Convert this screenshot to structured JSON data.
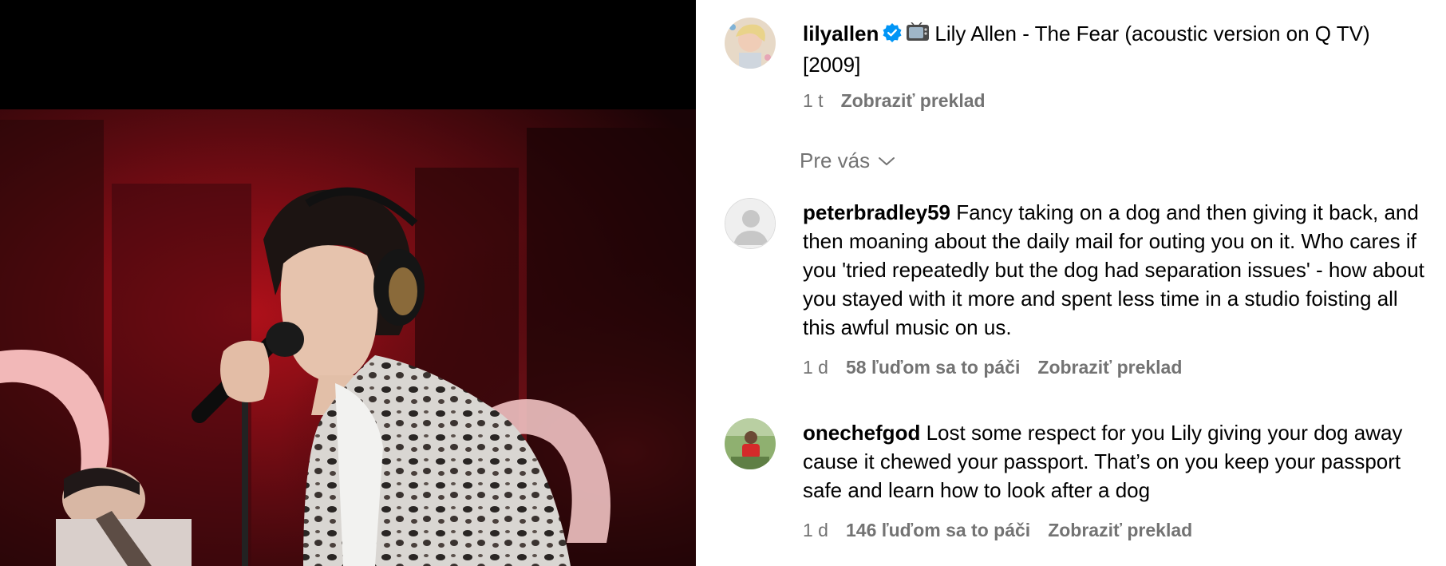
{
  "post": {
    "username": "lilyallen",
    "caption": "Lily Allen - The Fear (acoustic version on Q TV) [2009]",
    "time": "1 t",
    "translate_label": "Zobraziť preklad",
    "icons": {
      "verified": "verified-badge-icon",
      "emoji": "television-emoji-icon"
    }
  },
  "filter": {
    "label": "Pre vás",
    "icon": "chevron-down-icon"
  },
  "comments": [
    {
      "username": "peterbradley59",
      "text": "Fancy taking on a dog and then giving it back, and then moaning about the daily mail for outing you on it. Who cares if you 'tried repeatedly but the dog had separation issues' - how about you stayed with it more and spent less time in a studio foisting all this awful music on us.",
      "time": "1 d",
      "likes": "58 ľuďom sa to páči",
      "translate_label": "Zobraziť preklad"
    },
    {
      "username": "onechefgod",
      "text": "Lost some respect for you Lily giving your dog away cause it chewed your passport. That’s on you keep your passport safe and learn how to look after a dog",
      "time": "1 d",
      "likes": "146 ľuďom sa to páči",
      "translate_label": "Zobraziť preklad"
    }
  ],
  "colors": {
    "meta": "#737373",
    "verified": "#0095f6",
    "studio_red": "#a8121c"
  }
}
